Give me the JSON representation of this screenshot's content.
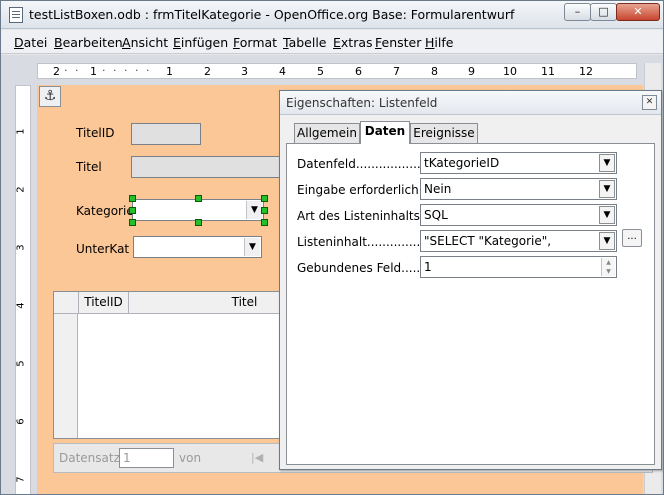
{
  "window": {
    "title": "testListBoxen.odb : frmTitelKategorie - OpenOffice.org Base: Formularentwurf",
    "min_glyph": "–",
    "max_glyph": "□",
    "close_glyph": "✕"
  },
  "menubar": {
    "items": [
      {
        "label": "Datei"
      },
      {
        "label": "Bearbeiten"
      },
      {
        "label": "Ansicht"
      },
      {
        "label": "Einfügen"
      },
      {
        "label": "Format"
      },
      {
        "label": "Tabelle"
      },
      {
        "label": "Extras"
      },
      {
        "label": "Fenster"
      },
      {
        "label": "Hilfe"
      }
    ]
  },
  "ruler": {
    "numbers": [
      "2",
      "1",
      "1",
      "2",
      "3",
      "4",
      "5",
      "6",
      "7",
      "8",
      "9",
      "10",
      "11",
      "12"
    ]
  },
  "vruler": {
    "numbers": [
      "1",
      "2",
      "3",
      "4",
      "5",
      "6",
      "7"
    ]
  },
  "form": {
    "anchor_glyph": "⚓",
    "fields": {
      "titelid_label": "TitelID",
      "titel_label": "Titel",
      "kategorie_label": "Kategorie",
      "unterkat_label": "UnterKat"
    },
    "grid": {
      "columns": [
        "TitelID",
        "Titel"
      ]
    },
    "navbar": {
      "label": "Datensatz",
      "record": "1",
      "of": "von",
      "first_glyph": "|◀"
    }
  },
  "dialog": {
    "title": "Eigenschaften: Listenfeld",
    "close_glyph": "✕",
    "tabs": [
      {
        "label": "Allgemein",
        "active": false
      },
      {
        "label": "Daten",
        "active": true
      },
      {
        "label": "Ereignisse",
        "active": false
      }
    ],
    "properties": [
      {
        "label": "Datenfeld......................",
        "value": "tKategorieID"
      },
      {
        "label": "Eingabe erforderlich......",
        "value": "Nein"
      },
      {
        "label": "Art des Listeninhalts......",
        "value": "SQL"
      },
      {
        "label": "Listeninhalt......................",
        "value": "\"SELECT \"Kategorie\","
      },
      {
        "label": "Gebundenes Feld...........",
        "value": "1"
      }
    ],
    "ellipsis_label": "..."
  },
  "colors": {
    "form_background": "#fbc796",
    "selection_handle": "#22c12a"
  }
}
